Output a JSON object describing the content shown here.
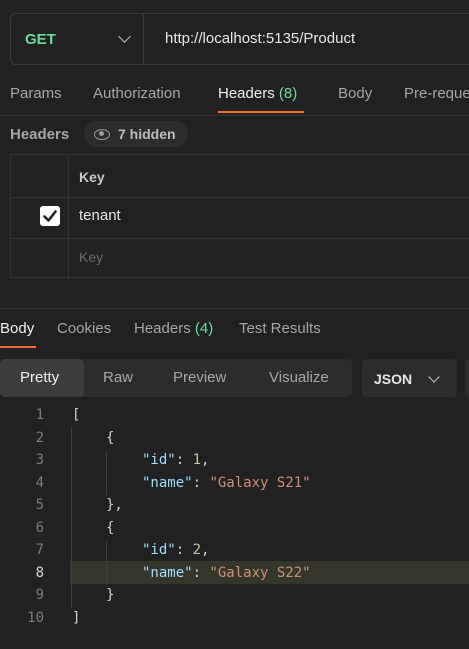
{
  "request": {
    "method": "GET",
    "url": "http://localhost:5135/Product"
  },
  "request_tabs": [
    {
      "label": "Params"
    },
    {
      "label": "Authorization"
    },
    {
      "label": "Headers",
      "count": "(8)"
    },
    {
      "label": "Body"
    },
    {
      "label": "Pre-reque"
    }
  ],
  "headers_section": {
    "title": "Headers",
    "hidden_label": "7 hidden",
    "column_key": "Key",
    "rows": [
      {
        "checked": true,
        "key": "tenant"
      }
    ],
    "new_key_placeholder": "Key"
  },
  "response_tabs": [
    {
      "label": "Body"
    },
    {
      "label": "Cookies"
    },
    {
      "label": "Headers",
      "count": "(4)"
    },
    {
      "label": "Test Results"
    }
  ],
  "view_modes": [
    "Pretty",
    "Raw",
    "Preview",
    "Visualize"
  ],
  "format": "JSON",
  "code_lines": [
    {
      "num": "1",
      "text": "["
    },
    {
      "num": "2",
      "text": "{"
    },
    {
      "num": "3",
      "key": "\"id\"",
      "value": "1"
    },
    {
      "num": "4",
      "key": "\"name\"",
      "value": "\"Galaxy S21\""
    },
    {
      "num": "5",
      "text": "},"
    },
    {
      "num": "6",
      "text": "{"
    },
    {
      "num": "7",
      "key": "\"id\"",
      "value": "2"
    },
    {
      "num": "8",
      "key": "\"name\"",
      "value": "\"Galaxy S22\""
    },
    {
      "num": "9",
      "text": "}"
    },
    {
      "num": "10",
      "text": "]"
    }
  ],
  "colors": {
    "accent": "#ff6c37",
    "method_green": "#6bdd9a",
    "json_key": "#9cdcfe",
    "json_string": "#ce9178",
    "json_number": "#b5cea8"
  }
}
